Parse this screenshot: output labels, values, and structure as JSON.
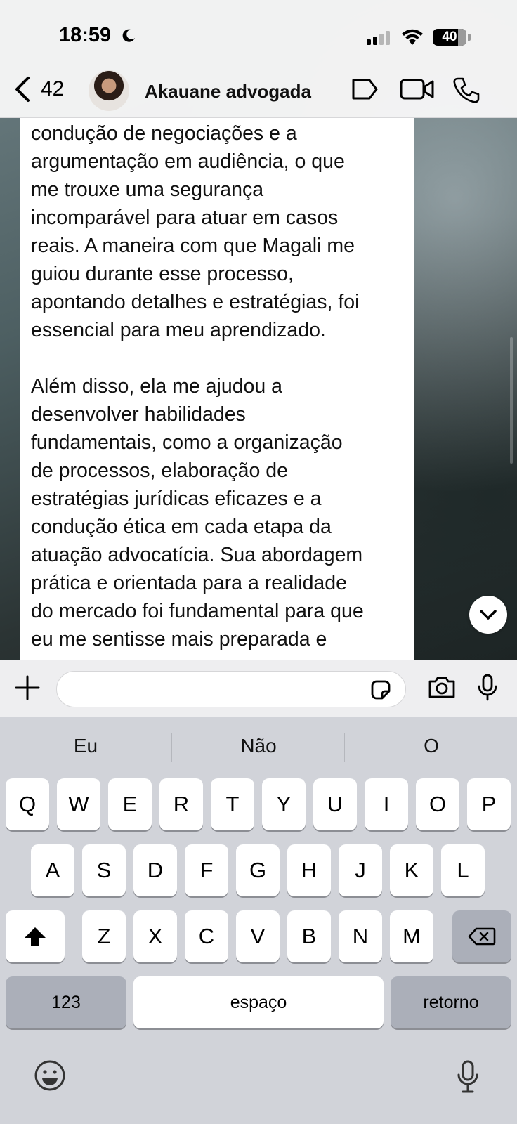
{
  "status_bar": {
    "time": "18:59",
    "battery": "40"
  },
  "header": {
    "back_count": "42",
    "contact_name": "Akauane advogada"
  },
  "message": {
    "lines": [
      "condução de negociações e a",
      "argumentação em audiência, o que",
      "me trouxe uma segurança",
      "incomparável para atuar em casos",
      "reais. A maneira com que Magali me",
      "guiou durante esse processo,",
      "apontando detalhes e estratégias, foi",
      "essencial para meu aprendizado.",
      "",
      "Além disso, ela me ajudou a",
      "desenvolver habilidades",
      "fundamentais, como a organização",
      "de processos, elaboração de",
      "estratégias jurídicas eficazes e a",
      "condução ética em cada etapa da",
      "atuação advocatícia. Sua abordagem",
      "prática e orientada para a realidade",
      "do mercado foi fundamental para que",
      "eu me sentisse mais preparada e"
    ]
  },
  "composer": {
    "input_value": ""
  },
  "keyboard": {
    "suggestions": [
      "Eu",
      "Não",
      "O"
    ],
    "row1": [
      "Q",
      "W",
      "E",
      "R",
      "T",
      "Y",
      "U",
      "I",
      "O",
      "P"
    ],
    "row2": [
      "A",
      "S",
      "D",
      "F",
      "G",
      "H",
      "J",
      "K",
      "L"
    ],
    "row3": [
      "Z",
      "X",
      "C",
      "V",
      "B",
      "N",
      "M"
    ],
    "numbers_label": "123",
    "space_label": "espaço",
    "return_label": "retorno"
  },
  "colors": {
    "header_bg": "#f6f6f6",
    "bubble_bg": "#ffffff",
    "keyboard_bg": "#d1d3d9",
    "key_bg": "#ffffff",
    "function_key_bg": "#abafb9"
  }
}
